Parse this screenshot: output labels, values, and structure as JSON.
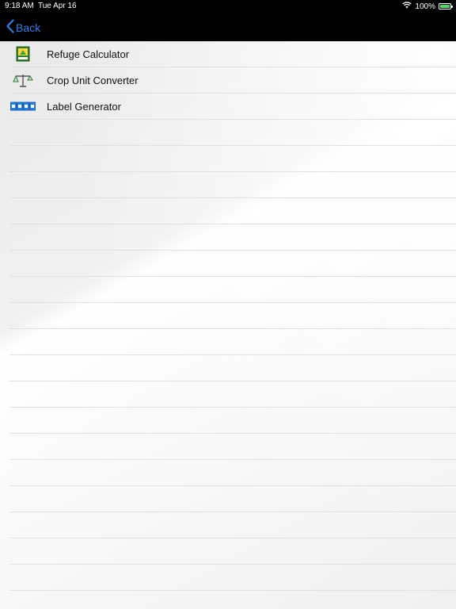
{
  "status_bar": {
    "time": "9:18 AM",
    "date": "Tue Apr 16",
    "battery": "100%",
    "wifi_icon": "wifi-icon",
    "battery_icon": "battery-charging-icon"
  },
  "nav": {
    "back_label": "Back",
    "back_icon": "chevron-left-icon"
  },
  "list": {
    "items": [
      {
        "label": "Refuge Calculator",
        "icon": "refuge-calculator-icon"
      },
      {
        "label": "Crop Unit Converter",
        "icon": "scale-icon"
      },
      {
        "label": "Label Generator",
        "icon": "label-icon"
      }
    ]
  },
  "colors": {
    "accent": "#2f7fe8",
    "bar_background": "#000000",
    "separator": "#e1e1e1",
    "battery_fill": "#4cd964"
  }
}
